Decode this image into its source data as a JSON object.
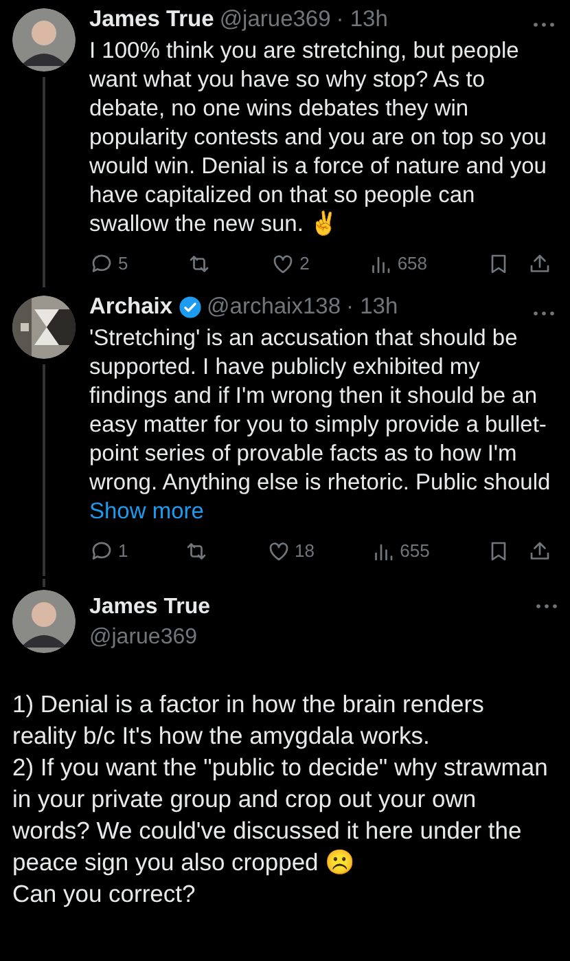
{
  "replies": [
    {
      "name": "James True",
      "handle": "@jarue369",
      "time": "· 13h",
      "verified": false,
      "kind": "person",
      "text": "I 100% think you are stretching, but people want what you have so why stop? As to debate, no one wins debates they win popularity contests and you are on top so you would win. Denial is a force of nature and you have capitalized on that so people can swallow the new sun. ✌️",
      "stats": {
        "replies": "5",
        "likes": "2",
        "views": "658"
      }
    },
    {
      "name": "Archaix",
      "handle": "@archaix138",
      "time": "· 13h",
      "verified": true,
      "kind": "pattern",
      "text": "'Stretching' is an accusation that should be supported.  I have publicly exhibited my findings and if I'm wrong then it should be an easy matter for you to simply provide a bullet-point series of provable facts as to how I'm wrong.  Anything else is rhetoric.  Public should",
      "show_more": "Show more",
      "stats": {
        "replies": "1",
        "likes": "18",
        "views": "655"
      }
    }
  ],
  "main_tweet": {
    "name": "James True",
    "handle": "@jarue369",
    "kind": "person",
    "paragraphs": [
      "1) Denial is a factor in how the brain renders reality b/c It's how the amygdala works.",
      "2) If you want the \"public to decide\" why strawman in your private group and crop out your own words? We could've discussed it here under the peace sign you also cropped ☹️",
      "Can you correct?"
    ]
  }
}
